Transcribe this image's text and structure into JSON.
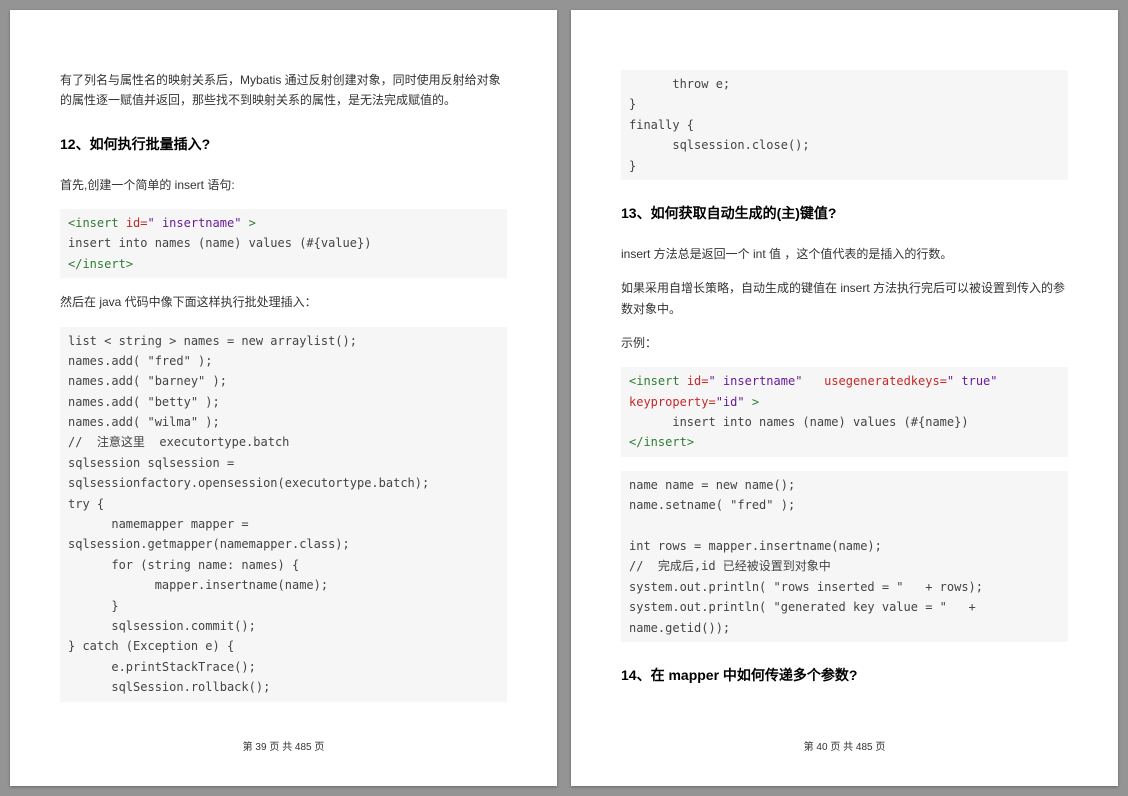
{
  "page_left": {
    "intro": "有了列名与属性名的映射关系后，Mybatis 通过反射创建对象，同时使用反射给对象的属性逐一赋值并返回，那些找不到映射关系的属性，是无法完成赋值的。",
    "heading12": "12、如何执行批量插入?",
    "first_line": "首先,创建一个简单的 insert 语句:",
    "code1": {
      "open_tag_lt": "<",
      "open_tag_name": "insert",
      "attr_id": " id=",
      "attr_id_val": "\" insertname\"",
      "open_tag_gt": " >",
      "body": "insert into names (name) values (#{value})",
      "close_lt": "</",
      "close_name": "insert",
      "close_gt": ">"
    },
    "then_line": "然后在 java 代码中像下面这样执行批处理插入：",
    "code2": "list < string > names = new arraylist();\nnames.add( \"fred\" );\nnames.add( \"barney\" );\nnames.add( \"betty\" );\nnames.add( \"wilma\" );\n//  注意这里  executortype.batch\nsqlsession sqlsession =\nsqlsessionfactory.opensession(executortype.batch);\ntry {\n      namemapper mapper = sqlsession.getmapper(namemapper.class);\n      for (string name: names) {\n            mapper.insertname(name);\n      }\n      sqlsession.commit();\n} catch (Exception e) {\n      e.printStackTrace();\n      sqlSession.rollback();",
    "footer": "第 39 页 共 485 页"
  },
  "page_right": {
    "code_cont": "      throw e;\n}\nfinally {\n      sqlsession.close();\n}",
    "heading13": "13、如何获取自动生成的(主)键值?",
    "p1": "insert 方法总是返回一个 int 值 ，这个值代表的是插入的行数。",
    "p2": "如果采用自增长策略，自动生成的键值在 insert 方法执行完后可以被设置到传入的参数对象中。",
    "p3": "示例：",
    "code3": {
      "lt": "<",
      "tag": "insert",
      "a_id": " id=",
      "v_id": "\" insertname\"",
      "a_ugk": "   usegeneratedkeys=",
      "v_ugk": "\" true\"",
      "a_kp": "   keyproperty=",
      "v_kp": "\"id\"",
      "gt": " >",
      "body": "      insert into names (name) values (#{name})",
      "close_lt": "</",
      "close_name": "insert",
      "close_gt": ">"
    },
    "code3b": "name name = new name();\nname.setname( \"fred\" );\n\nint rows = mapper.insertname(name);\n//  完成后,id 已经被设置到对象中\nsystem.out.println( \"rows inserted = \"   + rows);\nsystem.out.println( \"generated key value = \"   + name.getid());",
    "heading14": "14、在 mapper 中如何传递多个参数?",
    "footer": "第 40 页 共 485 页"
  }
}
